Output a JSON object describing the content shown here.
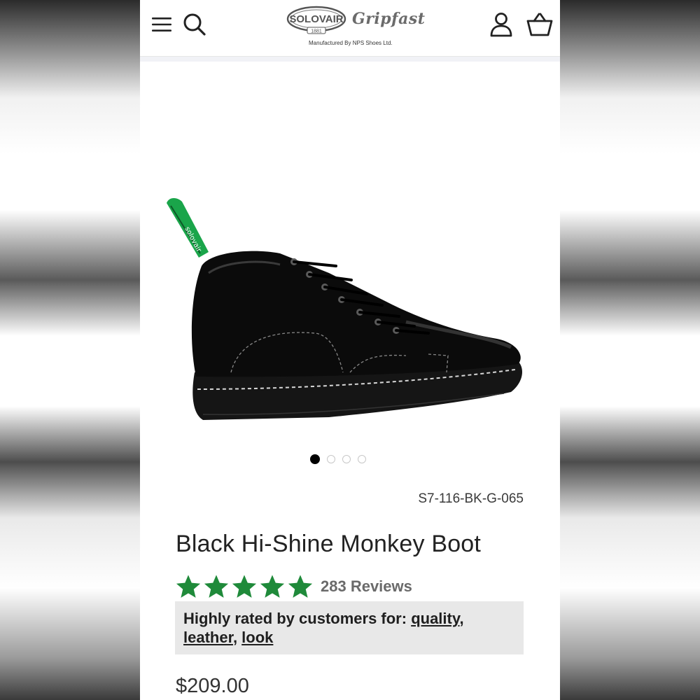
{
  "header": {
    "brand_logo": "SOLOVAIR",
    "brand_year": "1881",
    "brand_script": "Gripfast",
    "tagline": "Manufactured By NPS Shoes Ltd.",
    "icons": [
      "menu-icon",
      "search-icon",
      "account-icon",
      "basket-icon"
    ]
  },
  "gallery": {
    "image_count": 4,
    "active_index": 0,
    "handle_text": "solovair"
  },
  "product": {
    "sku": "S7-116-BK-G-065",
    "title": "Black Hi-Shine Monkey Boot",
    "rating_stars": 5,
    "reviews_label": "283 Reviews",
    "rated_prefix": "Highly rated by customers for:",
    "rated_tags": [
      "quality",
      "leather",
      "look"
    ],
    "price": "$209.00"
  },
  "colors": {
    "star_green": "#1f8a3a",
    "text_dark": "#222222",
    "box_gray": "#e8e8e8",
    "pull_tab_green": "#1aa54a"
  }
}
